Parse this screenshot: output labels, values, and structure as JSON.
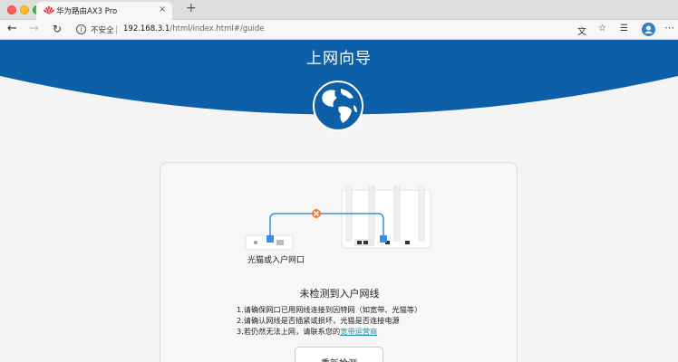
{
  "browser": {
    "tab_title": "华为路由AX3 Pro",
    "tab_close": "×",
    "new_tab": "+",
    "security_label": "不安全",
    "url_host": "192.168.3.1",
    "url_path": "/html/index.html#/guide",
    "icons": [
      "back-arrow",
      "forward-arrow",
      "reload",
      "info",
      "translate",
      "favorite-star",
      "collections",
      "profile-avatar",
      "more-menu"
    ]
  },
  "banner": {
    "title": "上网向导",
    "color": "#0d5fa8"
  },
  "diagram": {
    "modem_label": "光猫或入户网口",
    "error_color": "#f07c32",
    "cable_color": "#3a8fe0"
  },
  "status": {
    "title": "未检测到入户网线"
  },
  "tips": {
    "line1": "1.请确保网口已用网线连接到因特网（如宽带、光猫等）",
    "line2": "2.请确认网线是否插紧或损坏，光猫是否连接电源",
    "line3_prefix": "3.若仍然无法上网，请联系您的",
    "line3_link": "宽带运营商"
  },
  "actions": {
    "retry_label": "重新检测"
  }
}
